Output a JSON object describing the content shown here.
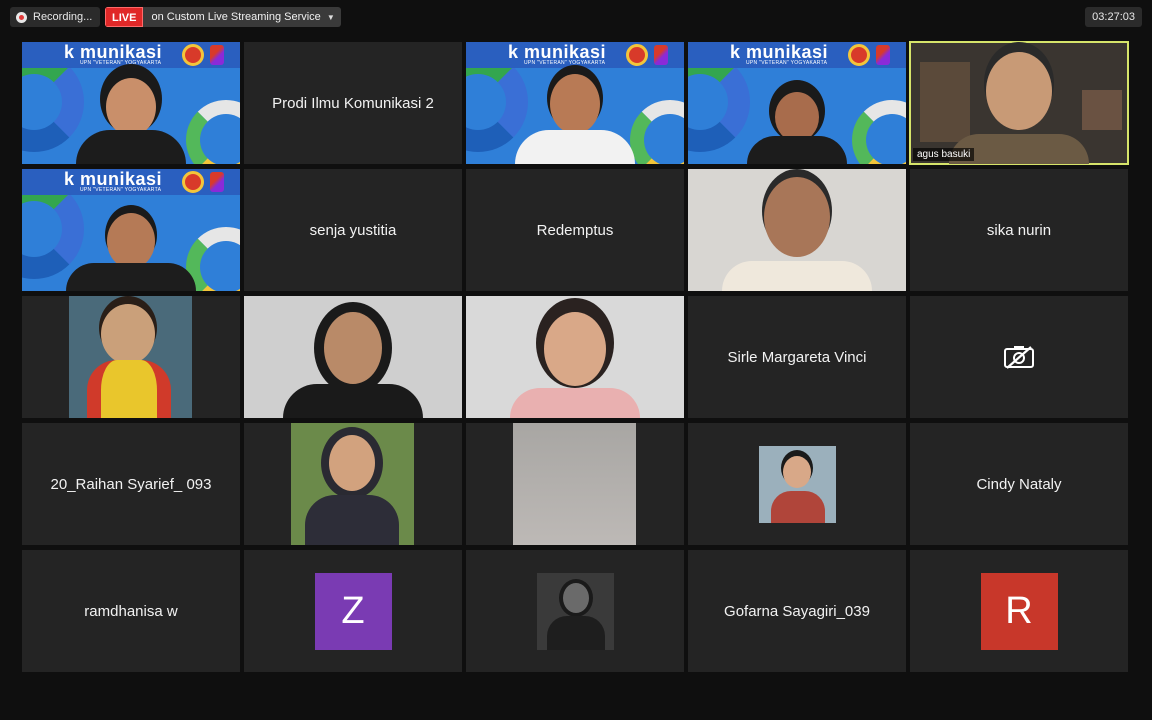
{
  "topbar": {
    "recording_label": "Recording...",
    "live_badge": "LIVE",
    "live_service": "on Custom Live Streaming Service",
    "timer": "03:27:03"
  },
  "brand": {
    "logo_text": "k munikasi",
    "logo_sub": "UPN \"VETERAN\" YOGYAKARTA"
  },
  "tiles": [
    {
      "type": "video-brand"
    },
    {
      "type": "name",
      "name": "Prodi Ilmu Komunikasi 2"
    },
    {
      "type": "video-brand"
    },
    {
      "type": "video-brand"
    },
    {
      "type": "video",
      "name": "agus basuki",
      "active": true
    },
    {
      "type": "video-brand"
    },
    {
      "type": "name",
      "name": "senja yustitia"
    },
    {
      "type": "name",
      "name": "Redemptus"
    },
    {
      "type": "video"
    },
    {
      "type": "name",
      "name": "sika nurin"
    },
    {
      "type": "photo"
    },
    {
      "type": "video"
    },
    {
      "type": "video"
    },
    {
      "type": "name",
      "name": "Sirle Margareta Vinci"
    },
    {
      "type": "camera-off",
      "icon": "camera-off-icon"
    },
    {
      "type": "name",
      "name": "20_Raihan Syarief_ 093"
    },
    {
      "type": "photo"
    },
    {
      "type": "photo"
    },
    {
      "type": "photo"
    },
    {
      "type": "name",
      "name": "Cindy Nataly"
    },
    {
      "type": "name",
      "name": "ramdhanisa w"
    },
    {
      "type": "avatar",
      "letter": "Z",
      "color": "#7a3bb3"
    },
    {
      "type": "photo"
    },
    {
      "type": "name",
      "name": "Gofarna Sayagiri_039"
    },
    {
      "type": "avatar",
      "letter": "R",
      "color": "#c8372a"
    }
  ]
}
